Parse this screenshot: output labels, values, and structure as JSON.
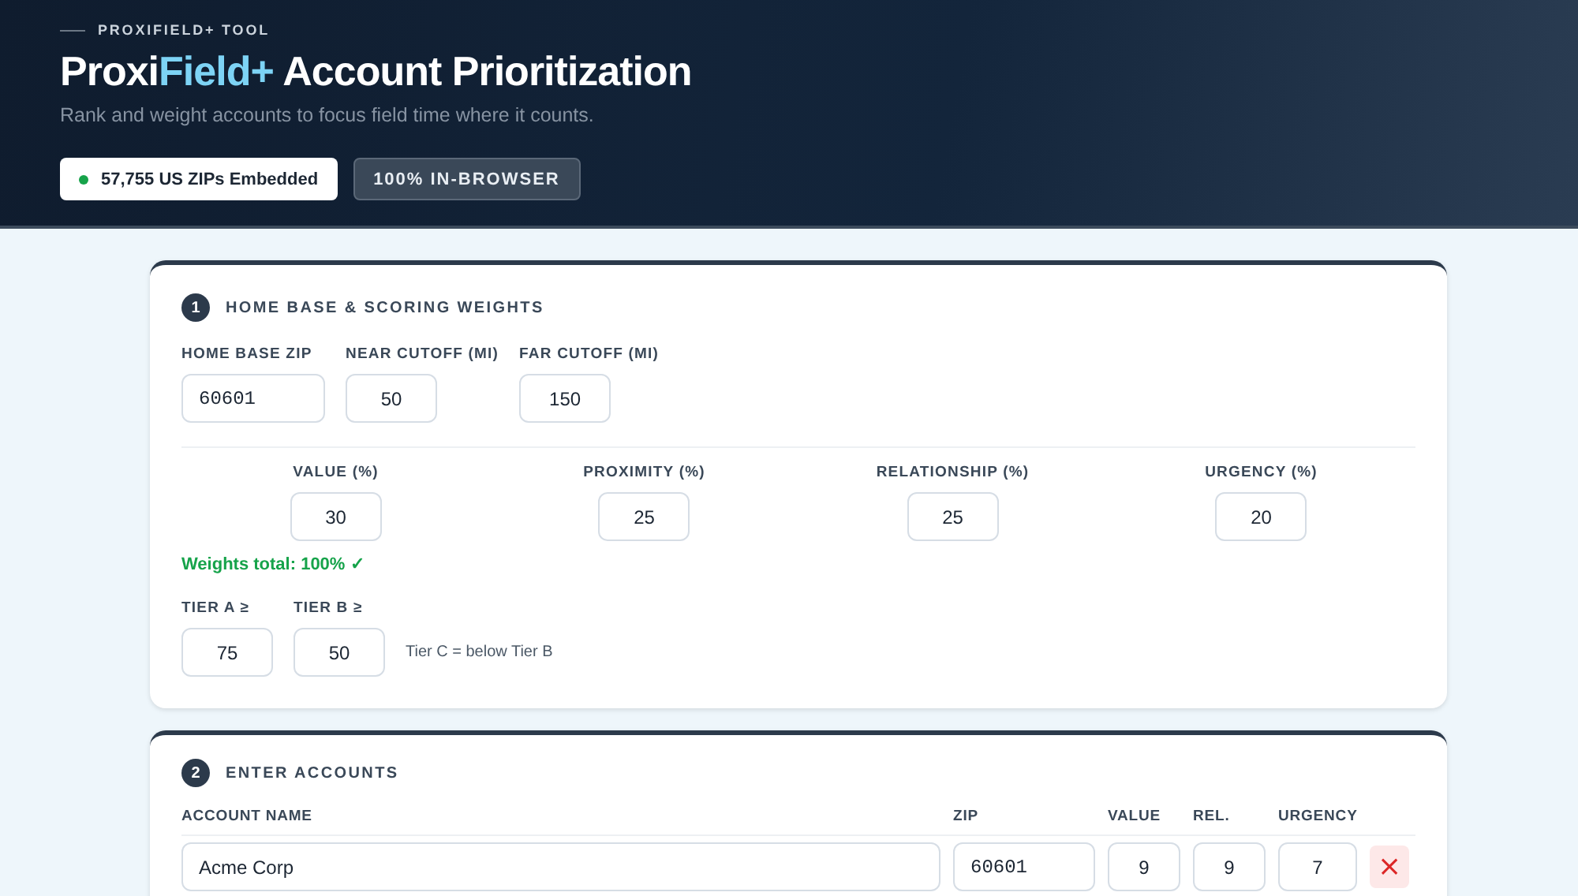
{
  "header": {
    "eyebrow": "PROXIFIELD+ TOOL",
    "title_parts": [
      {
        "text": "Proxi",
        "accent": false
      },
      {
        "text": "Field+",
        "accent": true
      },
      {
        "text": " Account Prioritization",
        "accent": false
      }
    ],
    "subtitle": "Rank and weight accounts to focus field time where it counts.",
    "badges": [
      {
        "kind": "status",
        "text": "57,755 US ZIPs Embedded"
      },
      {
        "kind": "outline",
        "text": "100% IN-BROWSER"
      }
    ]
  },
  "settings": {
    "step": "1",
    "title": "HOME BASE & SCORING WEIGHTS",
    "base_fields": [
      {
        "label": "HOME BASE ZIP",
        "value": "60601",
        "kind": "zip"
      },
      {
        "label": "NEAR CUTOFF (MI)",
        "value": "50",
        "kind": "number"
      },
      {
        "label": "FAR CUTOFF (MI)",
        "value": "150",
        "kind": "number"
      }
    ],
    "weights": [
      {
        "label": "VALUE (%)",
        "value": "30"
      },
      {
        "label": "PROXIMITY (%)",
        "value": "25"
      },
      {
        "label": "RELATIONSHIP (%)",
        "value": "25"
      },
      {
        "label": "URGENCY (%)",
        "value": "20"
      }
    ],
    "weights_total": "Weights total: 100% ✓",
    "tiers": [
      {
        "label": "TIER A ≥",
        "value": "75"
      },
      {
        "label": "TIER B ≥",
        "value": "50"
      }
    ],
    "tier_note": "Tier C = below Tier B"
  },
  "accounts": {
    "step": "2",
    "title": "ENTER ACCOUNTS",
    "columns": [
      "ACCOUNT NAME",
      "ZIP",
      "VALUE",
      "REL.",
      "URGENCY"
    ],
    "rows": [
      {
        "name": "Acme Corp",
        "zip": "60601",
        "value": "9",
        "rel": "9",
        "urgency": "7",
        "delete": "×"
      }
    ]
  }
}
